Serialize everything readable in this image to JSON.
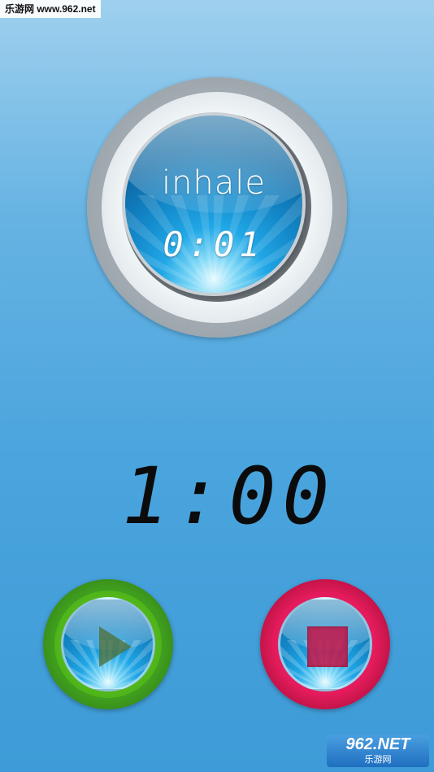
{
  "watermark": {
    "top_text": "乐游网 www.962.net",
    "bottom_brand": "962.NET",
    "bottom_sub": "乐游网"
  },
  "dial": {
    "phase_label": "inhale",
    "phase_time": "0:01"
  },
  "timer": {
    "total": "1:00"
  },
  "controls": {
    "play_icon": "play-icon",
    "stop_icon": "stop-icon",
    "play_color": "#3f9e1e",
    "stop_color": "#d91a55",
    "face_color": "#1387c8"
  }
}
